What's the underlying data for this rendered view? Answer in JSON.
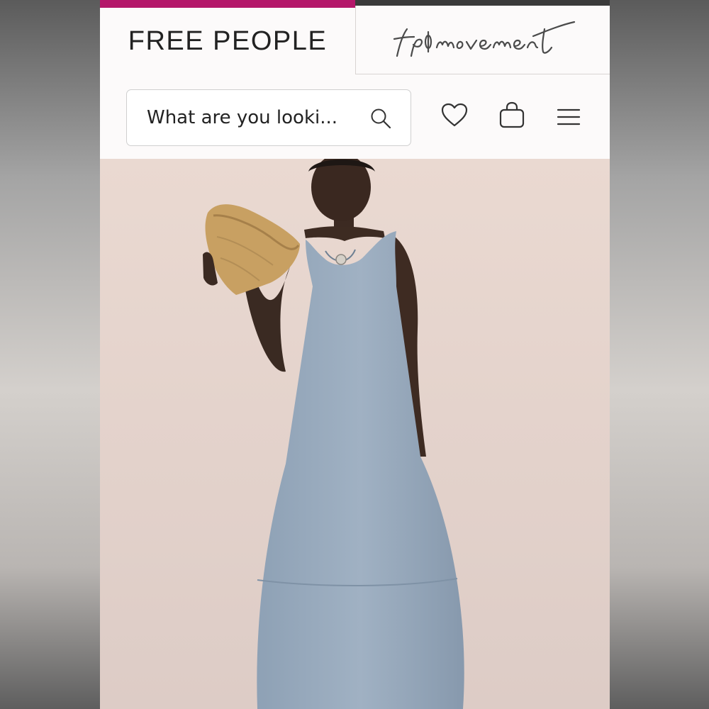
{
  "header": {
    "brand": "FREE PEOPLE",
    "sub_brand_logo": "fp movement",
    "search": {
      "placeholder": "What are you looki..."
    },
    "icons": [
      "search-icon",
      "heart-icon",
      "shopping-bag-icon",
      "hamburger-menu-icon"
    ]
  },
  "hero": {
    "image": "product-photo"
  },
  "colors": {
    "accent": "#b4176a",
    "header_bg": "#fcfafa",
    "photo_bg": "#e6d6cf",
    "dress": "#97a9bc"
  }
}
